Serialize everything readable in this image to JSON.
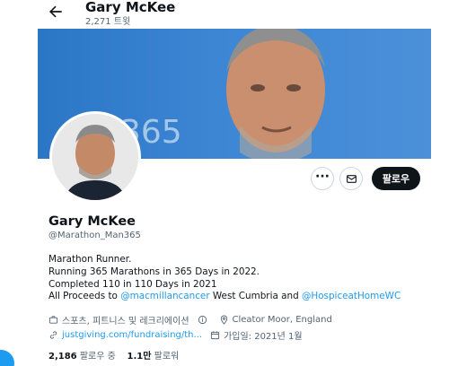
{
  "header": {
    "display_name": "Gary McKee",
    "tweet_count": "2,271 트윗"
  },
  "banner": {
    "text": "365"
  },
  "actions": {
    "more_label": "···",
    "follow_label": "팔로우"
  },
  "profile": {
    "display_name": "Gary McKee",
    "handle": "@Marathon_Man365",
    "bio": {
      "line1": "Marathon Runner.",
      "line2": "Running 365 Marathons in 365 Days in 2022.",
      "line3": "Completed 110 in 110 Days in 2021",
      "line4_prefix": "All Proceeds to ",
      "line4_link1": "@macmillancancer",
      "line4_mid": " West Cumbria and ",
      "line4_link2": "@HospiceatHomeWC"
    },
    "category": "스포츠, 피트니스 및 레크리에이션",
    "location": "Cleator Moor, England",
    "website": "justgiving.com/fundraising/th...",
    "joined": "가입일: 2021년 1월",
    "following_count": "2,186",
    "following_label": "팔로우 중",
    "followers_count": "1.1만",
    "followers_label": "팔로워"
  },
  "colors": {
    "accent": "#1d9bf0",
    "text_primary": "#0f1419",
    "text_secondary": "#536471",
    "banner_blue": "#3c86d4"
  },
  "icons": {
    "back": "arrow-left-icon",
    "more": "more-icon",
    "mail": "mail-icon",
    "category": "briefcase-icon",
    "info": "info-icon",
    "location": "location-pin-icon",
    "website": "link-icon",
    "joined": "calendar-icon"
  }
}
